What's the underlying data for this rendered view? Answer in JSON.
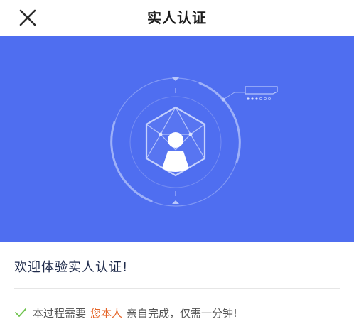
{
  "header": {
    "title": "实人认证",
    "close_icon": "close-icon"
  },
  "hero": {
    "background": "#4f6ef0",
    "icon": "face-scan-illustration"
  },
  "welcome": {
    "text": "欢迎体验实人认证!"
  },
  "info": {
    "icon": "check-icon",
    "check_color": "#6cc24a",
    "prefix": "本过程需要",
    "highlight": "您本人",
    "highlight_color": "#e5662a",
    "suffix": "亲自完成，仅需一分钟!"
  }
}
